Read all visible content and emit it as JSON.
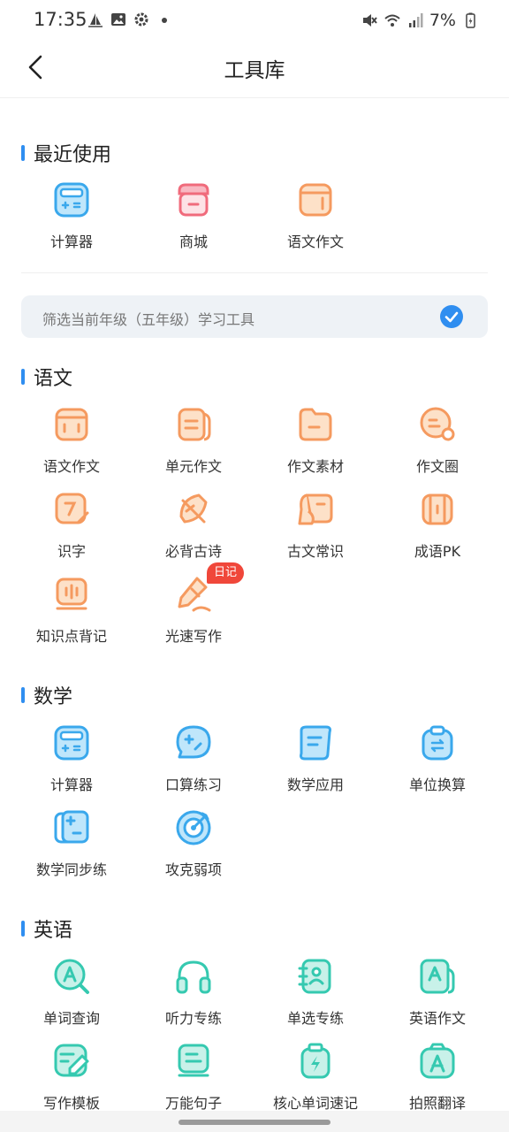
{
  "status_bar": {
    "time": "17:35",
    "battery": "7%"
  },
  "header": {
    "title": "工具库"
  },
  "recent": {
    "title": "最近使用",
    "items": [
      {
        "label": "计算器",
        "icon": "calculator-icon"
      },
      {
        "label": "商城",
        "icon": "store-icon"
      },
      {
        "label": "语文作文",
        "icon": "composition-icon"
      }
    ]
  },
  "filter": {
    "label": "筛选当前年级（五年级）学习工具",
    "checked": true
  },
  "chinese": {
    "title": "语文",
    "items": [
      {
        "label": "语文作文",
        "icon": "composition-icon"
      },
      {
        "label": "单元作文",
        "icon": "unit-essay-icon"
      },
      {
        "label": "作文素材",
        "icon": "folder-icon"
      },
      {
        "label": "作文圈",
        "icon": "chat-circle-icon"
      },
      {
        "label": "识字",
        "icon": "character-card-icon"
      },
      {
        "label": "必背古诗",
        "icon": "poem-fan-icon"
      },
      {
        "label": "古文常识",
        "icon": "scroll-icon"
      },
      {
        "label": "成语PK",
        "icon": "book-icon"
      },
      {
        "label": "知识点背记",
        "icon": "audio-book-icon"
      },
      {
        "label": "光速写作",
        "icon": "pen-icon",
        "badge": "日记"
      }
    ]
  },
  "math": {
    "title": "数学",
    "items": [
      {
        "label": "计算器",
        "icon": "calculator-icon"
      },
      {
        "label": "口算练习",
        "icon": "chat-bubble-icon"
      },
      {
        "label": "数学应用",
        "icon": "document-icon"
      },
      {
        "label": "单位换算",
        "icon": "clipboard-icon"
      },
      {
        "label": "数学同步练",
        "icon": "plus-minus-card-icon"
      },
      {
        "label": "攻克弱项",
        "icon": "target-icon"
      }
    ]
  },
  "english": {
    "title": "英语",
    "items": [
      {
        "label": "单词查询",
        "icon": "search-a-icon"
      },
      {
        "label": "听力专练",
        "icon": "headphones-icon"
      },
      {
        "label": "单选专练",
        "icon": "contact-book-icon"
      },
      {
        "label": "英语作文",
        "icon": "a-document-icon"
      },
      {
        "label": "写作模板",
        "icon": "edit-icon"
      },
      {
        "label": "万能句子",
        "icon": "sentence-book-icon"
      },
      {
        "label": "核心单词速记",
        "icon": "flash-battery-icon"
      },
      {
        "label": "拍照翻译",
        "icon": "photo-translate-icon"
      }
    ]
  },
  "colors": {
    "accent": "#2f8ef0",
    "math_blue": "#3aa8ec",
    "chinese_orange": "#f59a5f",
    "english_green": "#35c9b0",
    "store_pink": "#f06b7c",
    "badge_red": "#f0473a"
  }
}
